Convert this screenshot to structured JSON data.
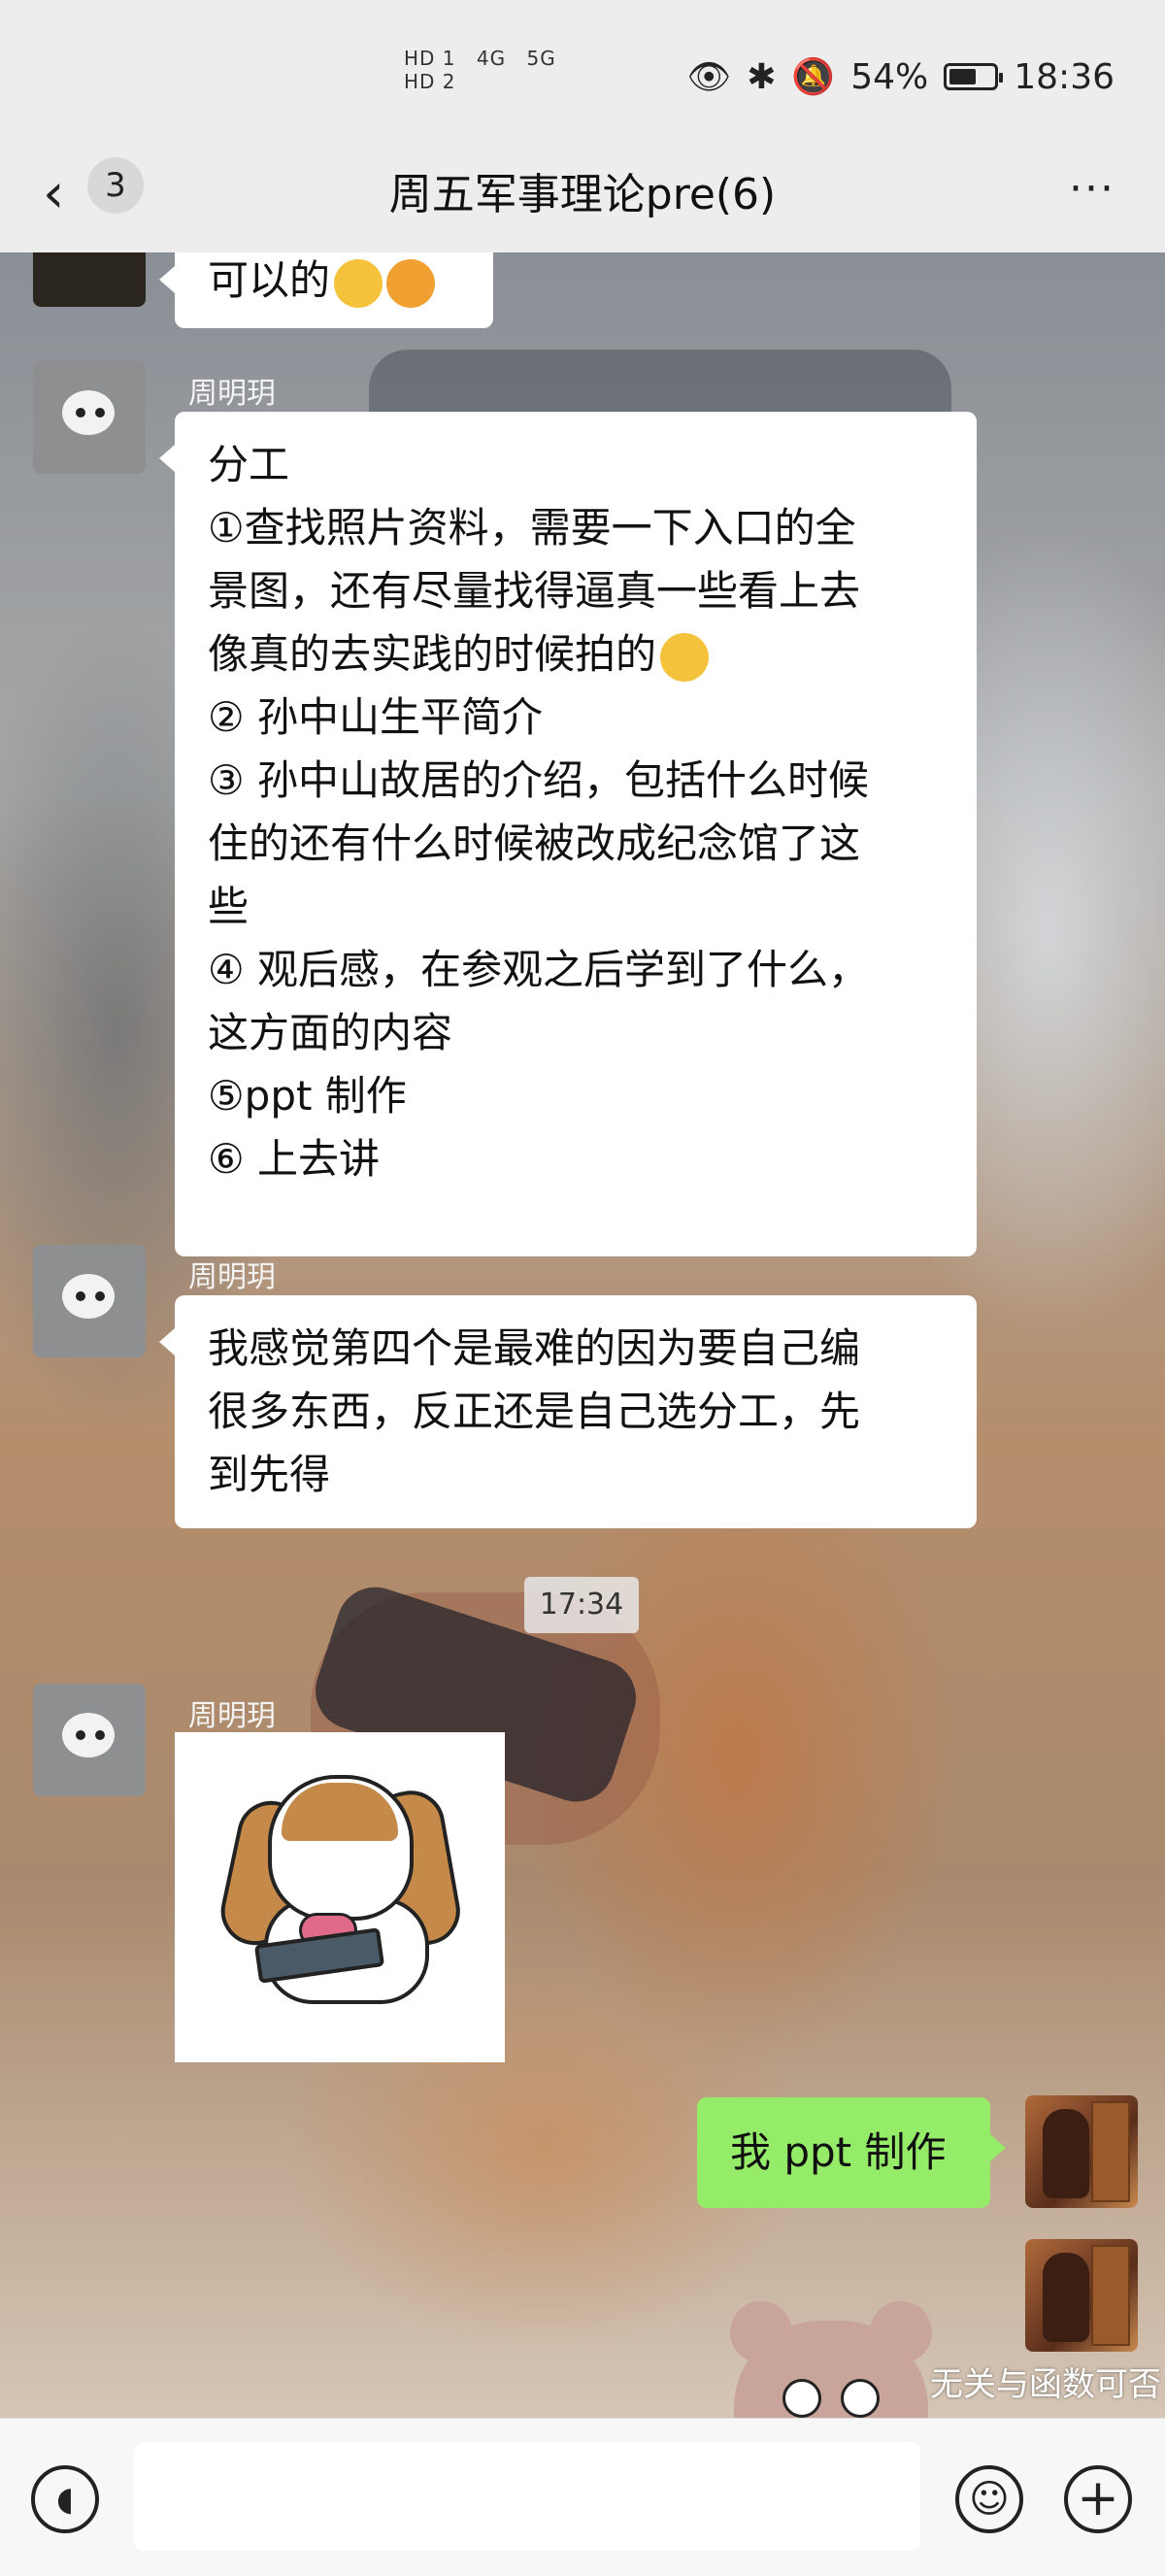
{
  "status_bar": {
    "network": [
      "HD 1",
      "4G",
      "5G",
      "HD 2"
    ],
    "battery_percent": "54%",
    "time": "18:36"
  },
  "header": {
    "back_badge": "3",
    "title": "周五军事理论pre(6)",
    "more_label": "···"
  },
  "messages": [
    {
      "type": "text",
      "side": "left",
      "lines": [
        "可以的"
      ]
    },
    {
      "type": "text",
      "side": "left",
      "sender": "周明玥",
      "lines": [
        "分工",
        "①查找照片资料，需要一下入口的全",
        "景图，还有尽量找得逼真一些看上去",
        "像真的去实践的时候拍的",
        "② 孙中山生平简介",
        "③ 孙中山故居的介绍，包括什么时候",
        "住的还有什么时候被改成纪念馆了这",
        "些",
        "④ 观后感，在参观之后学到了什么，",
        "这方面的内容",
        "⑤ppt 制作",
        "⑥ 上去讲"
      ]
    },
    {
      "type": "text",
      "side": "left",
      "sender": "周明玥",
      "lines": [
        "我感觉第四个是最难的因为要自己编",
        "很多东西，反正还是自己选分工，先",
        "到先得"
      ]
    },
    {
      "type": "time",
      "text": "17:34"
    },
    {
      "type": "sticker",
      "side": "left",
      "sender": "周明玥",
      "sticker": "dog-phone-sticker"
    },
    {
      "type": "text",
      "side": "right",
      "lines": [
        "我 ppt 制作"
      ]
    }
  ],
  "watermark": "无关与函数可否",
  "input_bar": {
    "value": "",
    "icons": [
      "voice-icon",
      "emoji-icon",
      "plus-icon"
    ]
  }
}
